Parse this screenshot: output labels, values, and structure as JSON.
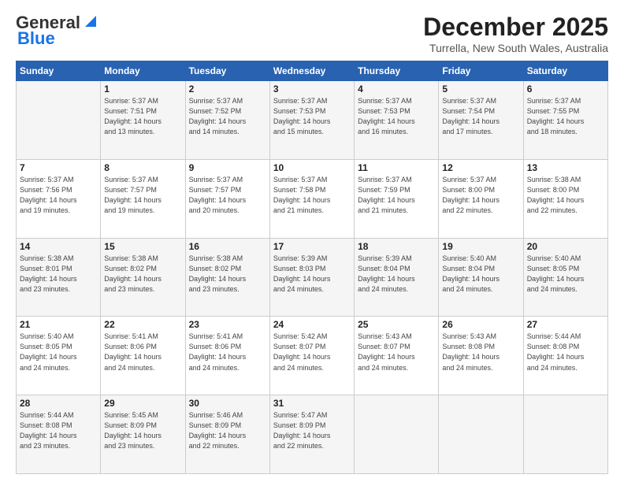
{
  "logo": {
    "line1": "General",
    "line2": "Blue"
  },
  "header": {
    "month": "December 2025",
    "location": "Turrella, New South Wales, Australia"
  },
  "weekdays": [
    "Sunday",
    "Monday",
    "Tuesday",
    "Wednesday",
    "Thursday",
    "Friday",
    "Saturday"
  ],
  "weeks": [
    [
      {
        "day": "",
        "info": ""
      },
      {
        "day": "1",
        "info": "Sunrise: 5:37 AM\nSunset: 7:51 PM\nDaylight: 14 hours\nand 13 minutes."
      },
      {
        "day": "2",
        "info": "Sunrise: 5:37 AM\nSunset: 7:52 PM\nDaylight: 14 hours\nand 14 minutes."
      },
      {
        "day": "3",
        "info": "Sunrise: 5:37 AM\nSunset: 7:53 PM\nDaylight: 14 hours\nand 15 minutes."
      },
      {
        "day": "4",
        "info": "Sunrise: 5:37 AM\nSunset: 7:53 PM\nDaylight: 14 hours\nand 16 minutes."
      },
      {
        "day": "5",
        "info": "Sunrise: 5:37 AM\nSunset: 7:54 PM\nDaylight: 14 hours\nand 17 minutes."
      },
      {
        "day": "6",
        "info": "Sunrise: 5:37 AM\nSunset: 7:55 PM\nDaylight: 14 hours\nand 18 minutes."
      }
    ],
    [
      {
        "day": "7",
        "info": "Sunrise: 5:37 AM\nSunset: 7:56 PM\nDaylight: 14 hours\nand 19 minutes."
      },
      {
        "day": "8",
        "info": "Sunrise: 5:37 AM\nSunset: 7:57 PM\nDaylight: 14 hours\nand 19 minutes."
      },
      {
        "day": "9",
        "info": "Sunrise: 5:37 AM\nSunset: 7:57 PM\nDaylight: 14 hours\nand 20 minutes."
      },
      {
        "day": "10",
        "info": "Sunrise: 5:37 AM\nSunset: 7:58 PM\nDaylight: 14 hours\nand 21 minutes."
      },
      {
        "day": "11",
        "info": "Sunrise: 5:37 AM\nSunset: 7:59 PM\nDaylight: 14 hours\nand 21 minutes."
      },
      {
        "day": "12",
        "info": "Sunrise: 5:37 AM\nSunset: 8:00 PM\nDaylight: 14 hours\nand 22 minutes."
      },
      {
        "day": "13",
        "info": "Sunrise: 5:38 AM\nSunset: 8:00 PM\nDaylight: 14 hours\nand 22 minutes."
      }
    ],
    [
      {
        "day": "14",
        "info": "Sunrise: 5:38 AM\nSunset: 8:01 PM\nDaylight: 14 hours\nand 23 minutes."
      },
      {
        "day": "15",
        "info": "Sunrise: 5:38 AM\nSunset: 8:02 PM\nDaylight: 14 hours\nand 23 minutes."
      },
      {
        "day": "16",
        "info": "Sunrise: 5:38 AM\nSunset: 8:02 PM\nDaylight: 14 hours\nand 23 minutes."
      },
      {
        "day": "17",
        "info": "Sunrise: 5:39 AM\nSunset: 8:03 PM\nDaylight: 14 hours\nand 24 minutes."
      },
      {
        "day": "18",
        "info": "Sunrise: 5:39 AM\nSunset: 8:04 PM\nDaylight: 14 hours\nand 24 minutes."
      },
      {
        "day": "19",
        "info": "Sunrise: 5:40 AM\nSunset: 8:04 PM\nDaylight: 14 hours\nand 24 minutes."
      },
      {
        "day": "20",
        "info": "Sunrise: 5:40 AM\nSunset: 8:05 PM\nDaylight: 14 hours\nand 24 minutes."
      }
    ],
    [
      {
        "day": "21",
        "info": "Sunrise: 5:40 AM\nSunset: 8:05 PM\nDaylight: 14 hours\nand 24 minutes."
      },
      {
        "day": "22",
        "info": "Sunrise: 5:41 AM\nSunset: 8:06 PM\nDaylight: 14 hours\nand 24 minutes."
      },
      {
        "day": "23",
        "info": "Sunrise: 5:41 AM\nSunset: 8:06 PM\nDaylight: 14 hours\nand 24 minutes."
      },
      {
        "day": "24",
        "info": "Sunrise: 5:42 AM\nSunset: 8:07 PM\nDaylight: 14 hours\nand 24 minutes."
      },
      {
        "day": "25",
        "info": "Sunrise: 5:43 AM\nSunset: 8:07 PM\nDaylight: 14 hours\nand 24 minutes."
      },
      {
        "day": "26",
        "info": "Sunrise: 5:43 AM\nSunset: 8:08 PM\nDaylight: 14 hours\nand 24 minutes."
      },
      {
        "day": "27",
        "info": "Sunrise: 5:44 AM\nSunset: 8:08 PM\nDaylight: 14 hours\nand 24 minutes."
      }
    ],
    [
      {
        "day": "28",
        "info": "Sunrise: 5:44 AM\nSunset: 8:08 PM\nDaylight: 14 hours\nand 23 minutes."
      },
      {
        "day": "29",
        "info": "Sunrise: 5:45 AM\nSunset: 8:09 PM\nDaylight: 14 hours\nand 23 minutes."
      },
      {
        "day": "30",
        "info": "Sunrise: 5:46 AM\nSunset: 8:09 PM\nDaylight: 14 hours\nand 22 minutes."
      },
      {
        "day": "31",
        "info": "Sunrise: 5:47 AM\nSunset: 8:09 PM\nDaylight: 14 hours\nand 22 minutes."
      },
      {
        "day": "",
        "info": ""
      },
      {
        "day": "",
        "info": ""
      },
      {
        "day": "",
        "info": ""
      }
    ]
  ]
}
